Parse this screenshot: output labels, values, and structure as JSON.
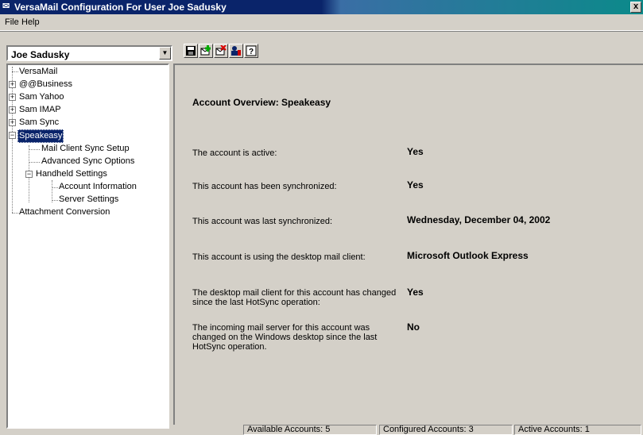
{
  "window": {
    "title": "VersaMail Configuration For User Joe Sadusky",
    "close_label": "x"
  },
  "menu": [
    {
      "label": "File"
    },
    {
      "label": "Help"
    }
  ],
  "user_select": {
    "value": "Joe Sadusky"
  },
  "toolbar": {
    "buttons": [
      {
        "icon": "save-icon"
      },
      {
        "icon": "add-account-icon"
      },
      {
        "icon": "delete-account-icon"
      },
      {
        "icon": "user-settings-icon"
      },
      {
        "icon": "help-icon"
      }
    ]
  },
  "tree": {
    "root": "VersaMail",
    "accounts": [
      "@@Business",
      "Sam Yahoo",
      "Sam IMAP",
      "Sam Sync",
      "Speakeasy"
    ],
    "speakeasy_children": [
      "Mail Client Sync Setup",
      "Advanced Sync Options",
      "Handheld Settings"
    ],
    "handheld_children": [
      "Account Information",
      "Server Settings"
    ],
    "other": "Attachment Conversion"
  },
  "panel": {
    "heading": "Account Overview: Speakeasy",
    "rows": [
      {
        "label": "The account is active:",
        "value": "Yes"
      },
      {
        "label": "This account has been synchronized:",
        "value": "Yes"
      },
      {
        "label": "This account was last synchronized:",
        "value": "Wednesday, December 04, 2002"
      },
      {
        "label": "This account is using the desktop mail client:",
        "value": "Microsoft Outlook Express"
      },
      {
        "label": "The desktop mail client for this account has changed since the last HotSync operation:",
        "value": "Yes"
      },
      {
        "label": "The incoming mail server for this account was changed on the Windows desktop since the last HotSync operation.",
        "value": "No"
      }
    ]
  },
  "status": {
    "available": "Available Accounts: 5",
    "configured": "Configured Accounts: 3",
    "active": "Active Accounts: 1"
  },
  "colors": {
    "title_bar": "#0a246a",
    "title_bar_end": "#0b8a8a",
    "selection": "#0a246a",
    "face": "#d4d0c8"
  }
}
